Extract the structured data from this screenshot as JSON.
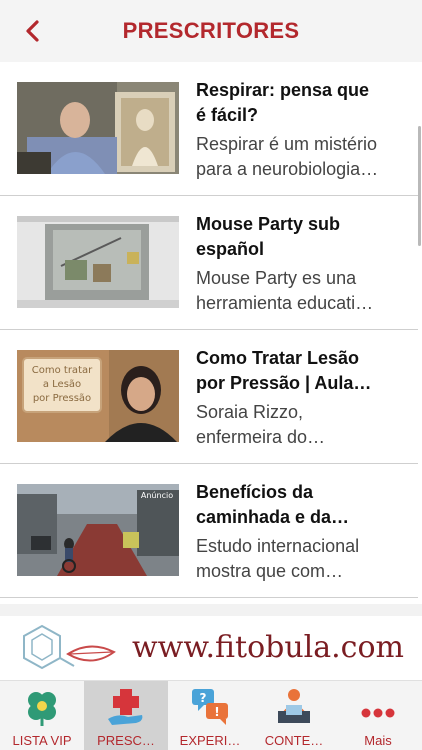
{
  "header": {
    "title": "PRESCRITORES"
  },
  "items": [
    {
      "title_l1": "Respirar: pensa que",
      "title_l2": "é fácil?",
      "desc_l1": "Respirar é um mistério",
      "desc_l2": "para a neurobiologia…"
    },
    {
      "title_l1": "Mouse Party sub",
      "title_l2": "español",
      "desc_l1": "Mouse Party es una",
      "desc_l2": "herramienta educati…"
    },
    {
      "title_l1": "Como Tratar Lesão",
      "title_l2": "por Pressão | Aula…",
      "desc_l1": "Soraia Rizzo,",
      "desc_l2": "enfermeira do…",
      "thumb_text_l1": "Como tratar",
      "thumb_text_l2": "a Lesão",
      "thumb_text_l3": "por Pressão"
    },
    {
      "title_l1": "Benefícios da",
      "title_l2": "caminhada e da…",
      "desc_l1": "Estudo internacional",
      "desc_l2": "mostra que com…",
      "thumb_text": "Anúncio"
    }
  ],
  "banner": {
    "url": "www.fitobula.com"
  },
  "tabs": [
    {
      "label": "LISTA VIP",
      "icon": "clover-icon"
    },
    {
      "label": "PRESC…",
      "icon": "medical-cross-icon",
      "active": true
    },
    {
      "label": "EXPERI…",
      "icon": "speech-bubbles-icon"
    },
    {
      "label": "CONTE…",
      "icon": "person-at-desk-icon"
    },
    {
      "label": "Mais",
      "icon": "more-dots-icon"
    }
  ],
  "colors": {
    "accent": "#b3282d",
    "banner_text": "#7a1d22",
    "active_tab": "#d2d2d2"
  }
}
